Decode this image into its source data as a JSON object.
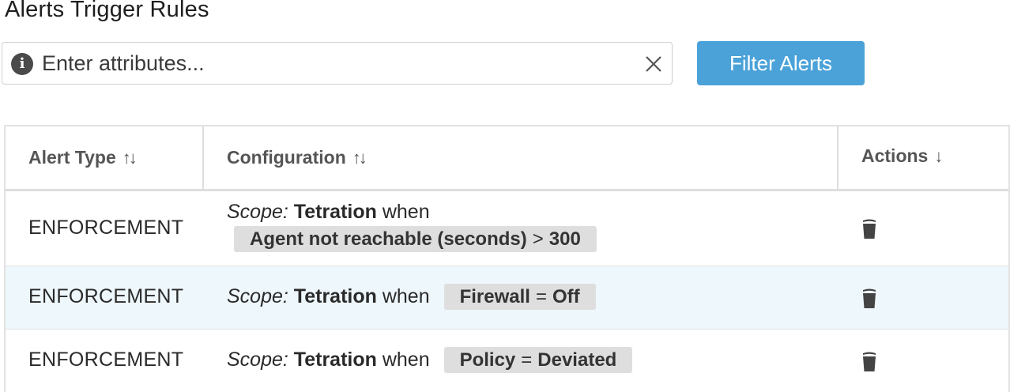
{
  "page": {
    "title": "Alerts Trigger Rules"
  },
  "search": {
    "placeholder": "Enter attributes...",
    "value": ""
  },
  "filter_button": {
    "label": "Filter Alerts"
  },
  "table": {
    "columns": [
      {
        "label": "Alert Type",
        "sort_icon": "↑↓"
      },
      {
        "label": "Configuration",
        "sort_icon": "↑↓"
      },
      {
        "label": "Actions",
        "sort_icon": "↓"
      }
    ],
    "rows": [
      {
        "type": "ENFORCEMENT",
        "scope_label": "Scope:",
        "scope": "Tetration",
        "when": "when",
        "attribute": "Agent not reachable (seconds)",
        "operator": ">",
        "value": "300"
      },
      {
        "type": "ENFORCEMENT",
        "scope_label": "Scope:",
        "scope": "Tetration",
        "when": "when",
        "attribute": "Firewall",
        "operator": "=",
        "value": "Off"
      },
      {
        "type": "ENFORCEMENT",
        "scope_label": "Scope:",
        "scope": "Tetration",
        "when": "when",
        "attribute": "Policy",
        "operator": "=",
        "value": "Deviated"
      }
    ]
  },
  "icons": {
    "info": "info-icon",
    "clear": "close-icon",
    "delete": "trash-icon"
  },
  "colors": {
    "accent": "#4aa2d9",
    "row_highlight": "#eef7fc",
    "pill": "#dedede"
  }
}
